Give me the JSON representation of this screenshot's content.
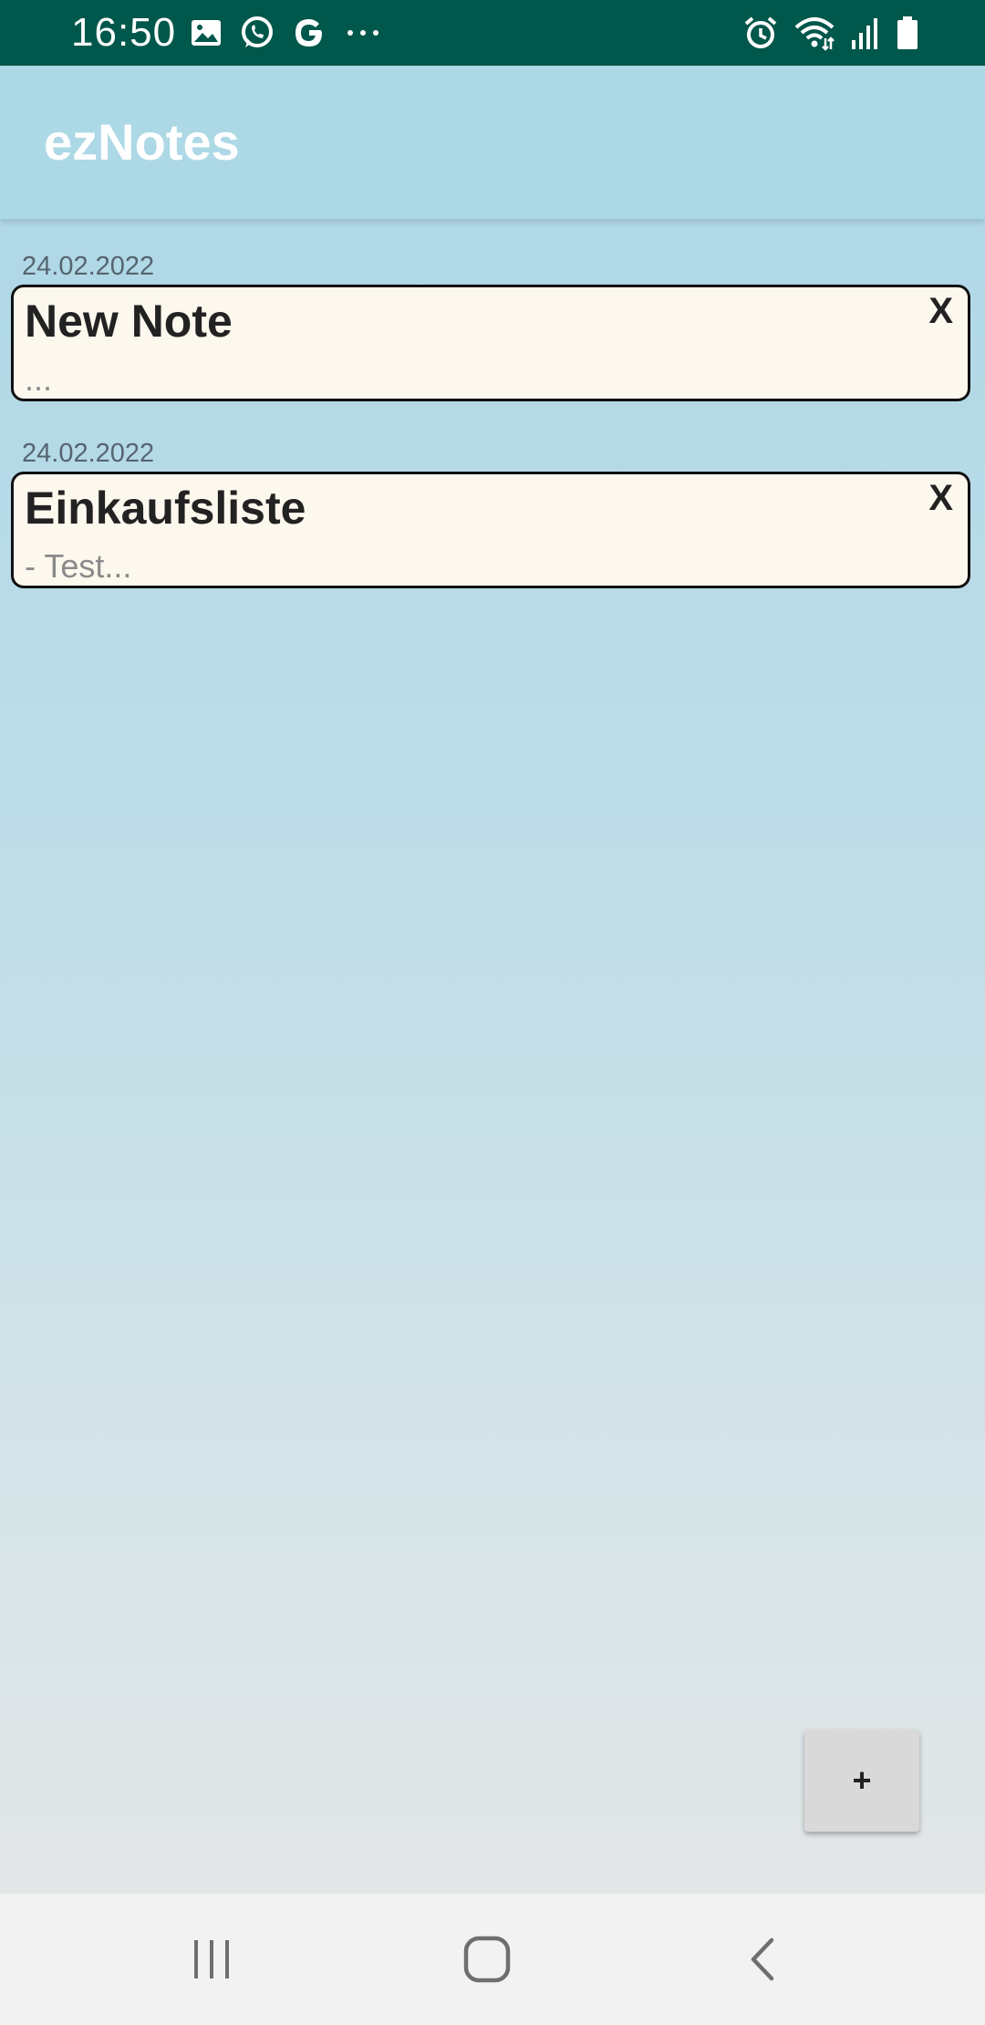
{
  "status_bar": {
    "time": "16:50",
    "left_icons": [
      "image-icon",
      "whatsapp-icon",
      "google-icon",
      "more-dots-icon"
    ],
    "right_icons": [
      "alarm-icon",
      "wifi-icon",
      "signal-icon",
      "battery-icon"
    ],
    "more_glyph": "···"
  },
  "app_bar": {
    "title": "ezNotes"
  },
  "notes": [
    {
      "date": "24.02.2022",
      "title": "New Note",
      "preview": "...",
      "delete_label": "X"
    },
    {
      "date": "24.02.2022",
      "title": "Einkaufsliste",
      "preview": "- Test...",
      "delete_label": "X"
    }
  ],
  "add_button": {
    "label": "+"
  },
  "nav_bar": {
    "buttons": [
      "recent-apps-icon",
      "home-icon",
      "back-icon"
    ]
  },
  "colors": {
    "status_bar": "#00574b",
    "app_bar": "#add8e6",
    "card_background": "#fdf8ee",
    "card_border": "#111111",
    "fab": "#d9d9d9",
    "nav_bar": "#f2f2f2"
  }
}
